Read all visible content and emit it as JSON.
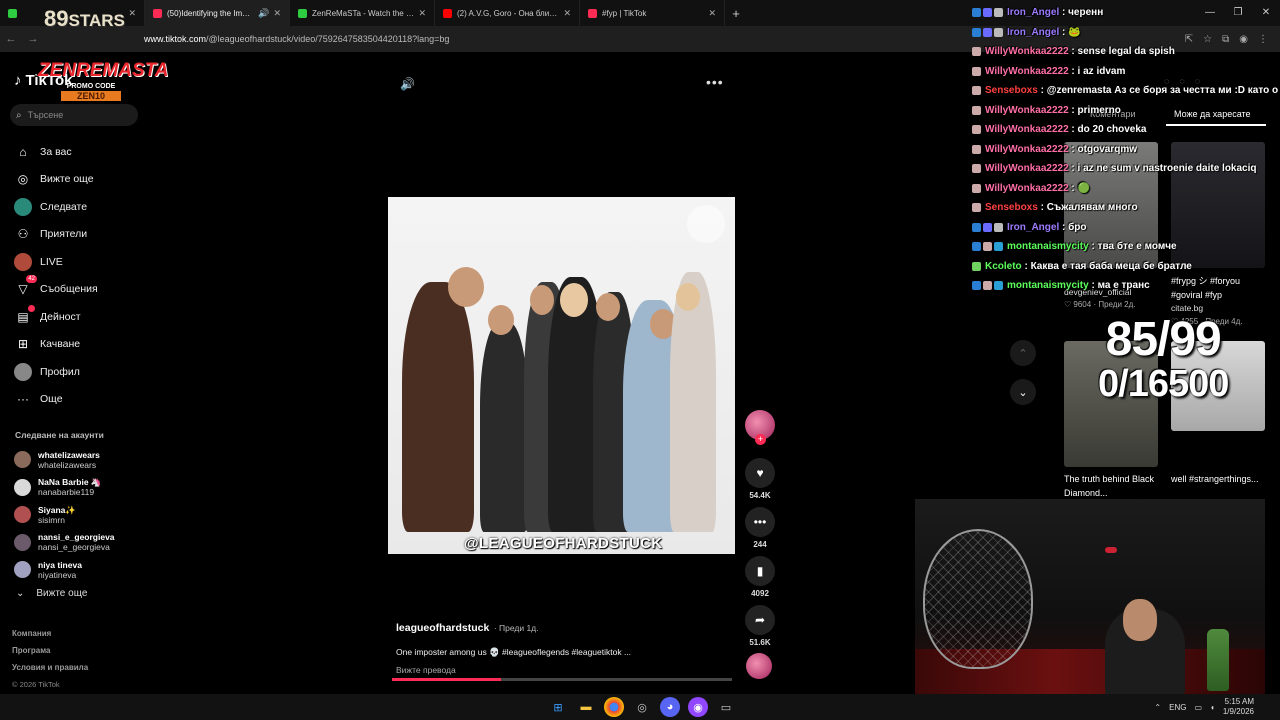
{
  "browser": {
    "tabs": [
      {
        "title": "",
        "favicon_color": "#2ecc40",
        "active": false
      },
      {
        "title": "(50)Identifying the Impost",
        "favicon_color": "#fe2c55",
        "active": true,
        "audio": true
      },
      {
        "title": "ZenReMaSTa - Watch the VOD",
        "favicon_color": "#2ecc40",
        "active": false
      },
      {
        "title": "(2) A.V.G, Goro - Она близко (",
        "favicon_color": "#ff0000",
        "active": false
      },
      {
        "title": "#fyp | TikTok",
        "favicon_color": "#fe2c55",
        "active": false
      }
    ],
    "url_host": "www.tiktok.com",
    "url_path": "/@leagueofhardstuck/video/7592647583504420118?lang=bg"
  },
  "overlay": {
    "stars_num": "89",
    "stars_text": "STARS",
    "zen_name": "ZENREMASTA",
    "promo_label": "PROMO CODE",
    "promo_code": "ZEN10"
  },
  "sidebar": {
    "logo": "TikTok",
    "search_placeholder": "Търсене",
    "items": [
      {
        "label": "За вас",
        "icon": "home-icon"
      },
      {
        "label": "Вижте още",
        "icon": "compass-icon"
      },
      {
        "label": "Следвате",
        "icon": "following-avatar"
      },
      {
        "label": "Приятели",
        "icon": "friends-icon"
      },
      {
        "label": "LIVE",
        "icon": "live-avatar"
      },
      {
        "label": "Съобщения",
        "icon": "messages-icon",
        "badge": "42"
      },
      {
        "label": "Дейност",
        "icon": "activity-icon",
        "dot": true
      },
      {
        "label": "Качване",
        "icon": "upload-icon"
      },
      {
        "label": "Профил",
        "icon": "profile-avatar"
      },
      {
        "label": "Още",
        "icon": "more-icon"
      }
    ],
    "following_title": "Следване на акаунти",
    "accounts": [
      {
        "name": "whatelizawears",
        "handle": "whatelizawears",
        "color": "#8a6a5a"
      },
      {
        "name": "NaNa Barbie 🦄",
        "handle": "nanabarbie119",
        "color": "#d9d9d9"
      },
      {
        "name": "Siyana✨",
        "handle": "sisimrn",
        "color": "#b05050"
      },
      {
        "name": "nansi_e_georgieva",
        "handle": "nansi_e_georgieva",
        "color": "#6a5a6a"
      },
      {
        "name": "niya tineva",
        "handle": "niyatineva",
        "color": "#a0a0c0"
      }
    ],
    "see_more": "Вижте още",
    "footer": [
      "Компания",
      "Програма",
      "Условия и правила"
    ],
    "copyright": "© 2026 TikTok"
  },
  "video": {
    "watermark": "@LEAGUEOFHARDSTUCK",
    "author": "leagueofhardstuck",
    "posted": "· Преди 1д.",
    "description": "One imposter among us 💀 #leagueoflegends #leaguetiktok ...",
    "translate": "Вижте превода",
    "progress": 0.32,
    "likes": "54.4K",
    "comments": "244",
    "saves": "4092",
    "shares": "51.6K"
  },
  "right_panel": {
    "tab_comments": "Коментари",
    "tab_maylike": "Може да харесате",
    "cards": [
      {
        "author": "devgeniev_official",
        "likes": "9604",
        "ago": "· Преди 2д.",
        "title": ""
      },
      {
        "author": "citate.bg",
        "likes": "4255",
        "ago": "· Преди 4д.",
        "title": "#frypg シ #foryou #goviral #fyp"
      },
      {
        "author": "",
        "likes": "",
        "ago": "",
        "title": "The truth behind Black Diamond..."
      },
      {
        "author": "",
        "likes": "",
        "ago": "",
        "title": "well #strangerthings..."
      }
    ]
  },
  "chat": [
    {
      "user": "Iron_Angel",
      "color": "#9b7bff",
      "msg": "черенн",
      "badges": [
        "#2a7fd4",
        "#6a6aff",
        "#bbb"
      ]
    },
    {
      "user": "Iron_Angel",
      "color": "#9b7bff",
      "msg": "🐸",
      "badges": [
        "#2a7fd4",
        "#6a6aff",
        "#bbb"
      ]
    },
    {
      "user": "WillyWonkaa2222",
      "color": "#ff6fa5",
      "msg": "sense legal da spish",
      "badges": [
        "#caa"
      ]
    },
    {
      "user": "WillyWonkaa2222",
      "color": "#ff6fa5",
      "msg": "i az idvam",
      "badges": [
        "#caa"
      ]
    },
    {
      "user": "Senseboxs",
      "color": "#ff4040",
      "msg": "@zenremasta Аз се боря за честта ми :D като о",
      "badges": [
        "#caa"
      ]
    },
    {
      "user": "WillyWonkaa2222",
      "color": "#ff6fa5",
      "msg": "primerno",
      "badges": [
        "#caa"
      ]
    },
    {
      "user": "WillyWonkaa2222",
      "color": "#ff6fa5",
      "msg": "do 20 choveka",
      "badges": [
        "#caa"
      ]
    },
    {
      "user": "WillyWonkaa2222",
      "color": "#ff6fa5",
      "msg": "otgovarqmw",
      "badges": [
        "#caa"
      ]
    },
    {
      "user": "WillyWonkaa2222",
      "color": "#ff6fa5",
      "msg": "i az ne sum v nastroenie daite lokaciq",
      "badges": [
        "#caa"
      ]
    },
    {
      "user": "WillyWonkaa2222",
      "color": "#ff6fa5",
      "msg": "🟢",
      "badges": [
        "#caa"
      ]
    },
    {
      "user": "Senseboxs",
      "color": "#ff4040",
      "msg": "Съжалявам много",
      "badges": [
        "#caa"
      ]
    },
    {
      "user": "Iron_Angel",
      "color": "#9b7bff",
      "msg": "бро",
      "badges": [
        "#2a7fd4",
        "#6a6aff",
        "#bbb"
      ]
    },
    {
      "user": "montanaismycity",
      "color": "#5cff5c",
      "msg": "тва бте е момче",
      "badges": [
        "#2a7fd4",
        "#caa",
        "#2a9fd4"
      ]
    },
    {
      "user": "Kcoleto",
      "color": "#5cff5c",
      "msg": "Каква е тая баба меца бе братле",
      "badges": [
        "#6fd45f"
      ]
    },
    {
      "user": "montanaismycity",
      "color": "#5cff5c",
      "msg": "ма е транс",
      "badges": [
        "#2a7fd4",
        "#caa",
        "#2a9fd4"
      ]
    }
  ],
  "counter": {
    "line1": "85/99",
    "line2": "0/16500"
  },
  "taskbar": {
    "lang": "ENG",
    "time": "5:15 AM",
    "date": "1/9/2026"
  }
}
